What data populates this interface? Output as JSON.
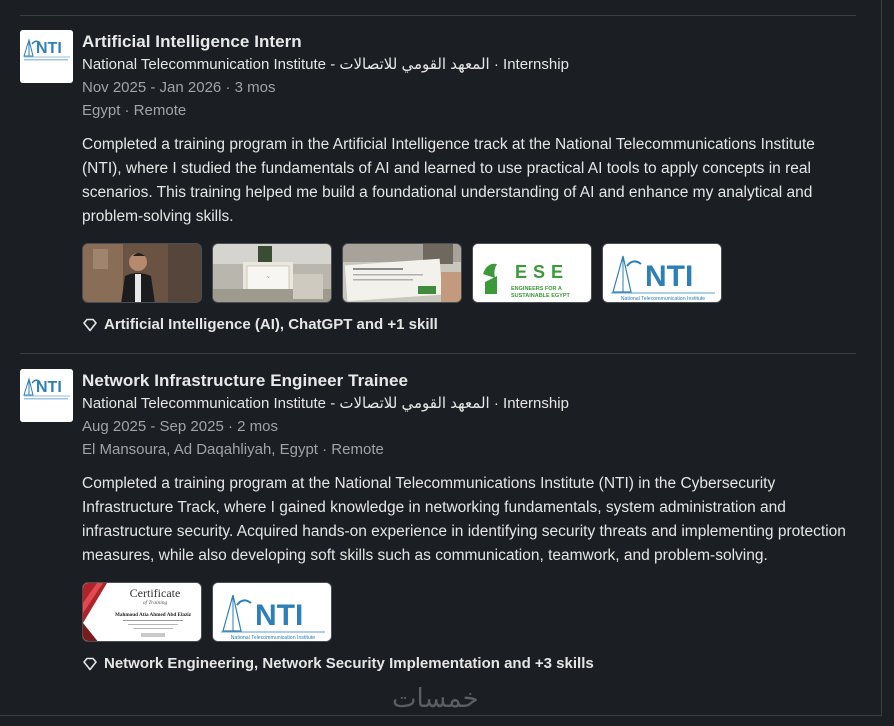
{
  "experience": [
    {
      "title": "Artificial Intelligence Intern",
      "org": "National Telecommunication Institute - المعهد القومي للاتصالات · Internship",
      "dates": "Nov 2025 - Jan 2026 · 3 mos",
      "location": "Egypt · Remote",
      "description": "Completed a training program in the Artificial Intelligence track at the National Telecommunications Institute (NTI), where I studied the fundamentals of AI and learned to use practical AI tools to apply concepts in real scenarios. This training helped me build a foundational understanding of AI and enhance my analytical and problem-solving skills.",
      "skills": "Artificial Intelligence (AI), ChatGPT and +1 skill",
      "logo_text": "NTI",
      "media": [
        {
          "kind": "photo-person"
        },
        {
          "kind": "photo-certificate"
        },
        {
          "kind": "photo-certificate-hand"
        },
        {
          "kind": "ese-logo",
          "big": "ESE",
          "line1": "ENGINEERS FOR A",
          "line2": "SUSTAINABLE EGYPT"
        },
        {
          "kind": "nti-logo",
          "big": "NTI",
          "caption": "National Telecommunication Institute"
        }
      ]
    },
    {
      "title": "Network Infrastructure Engineer Trainee",
      "org": "National Telecommunication Institute - المعهد القومي للاتصالات · Internship",
      "dates": "Aug 2025 - Sep 2025 · 2 mos",
      "location": "El Mansoura, Ad Daqahliyah, Egypt · Remote",
      "description": "Completed a training program at the National Telecommunications Institute (NTI) in the Cybersecurity Infrastructure Track, where I gained knowledge in networking fundamentals, system administration and infrastructure security. Acquired hands-on experience in identifying security threats and implementing protection measures, while also developing soft skills such as communication, teamwork, and problem-solving.",
      "skills": "Network Engineering, Network Security Implementation and +3 skills",
      "logo_text": "NTI",
      "media": [
        {
          "kind": "certificate",
          "heading": "Certificate",
          "sub": "of Training",
          "name": "Mahmoud Atia Ahmed Abd Elaziz"
        },
        {
          "kind": "nti-logo",
          "big": "NTI",
          "caption": "National Telecommunication Institute"
        }
      ]
    }
  ],
  "watermark": "خمسات",
  "colors": {
    "background": "#1b1f23",
    "text_primary": "#e6e6e6",
    "text_secondary": "#a0a4a8",
    "divider": "#3a3f44",
    "nti_blue": "#2d7fb8"
  },
  "icons": {
    "skills": "diamond-icon"
  }
}
